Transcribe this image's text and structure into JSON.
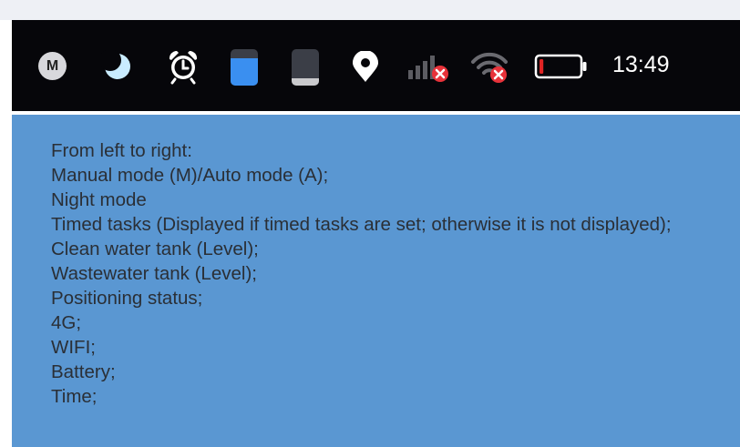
{
  "status_bar": {
    "mode_label": "M",
    "time": "13:49",
    "icons": [
      "manual-mode-icon",
      "night-mode-icon",
      "alarm-icon",
      "clean-water-tank-icon",
      "wastewater-tank-icon",
      "location-pin-icon",
      "cellular-signal-4g-icon",
      "wifi-disconnected-icon",
      "battery-low-icon"
    ],
    "colors": {
      "background": "#06060a",
      "clean_water": "#3a8ff0",
      "battery_low": "#e02424",
      "error_badge": "#e8323a"
    },
    "clean_water_level": 0.75,
    "wastewater_level": 0.2,
    "battery_level": 0.1
  },
  "legend": {
    "lines": [
      "From left to right:",
      "Manual mode (M)/Auto mode (A);",
      "Night mode",
      "Timed tasks (Displayed if timed tasks are set; otherwise it is not displayed);",
      "Clean water tank (Level);",
      "Wastewater tank (Level);",
      "Positioning status;",
      "4G;",
      "WIFI;",
      "Battery;",
      "Time;"
    ]
  },
  "colors": {
    "panel": "#5a97d2",
    "text": "#2a2f36"
  }
}
